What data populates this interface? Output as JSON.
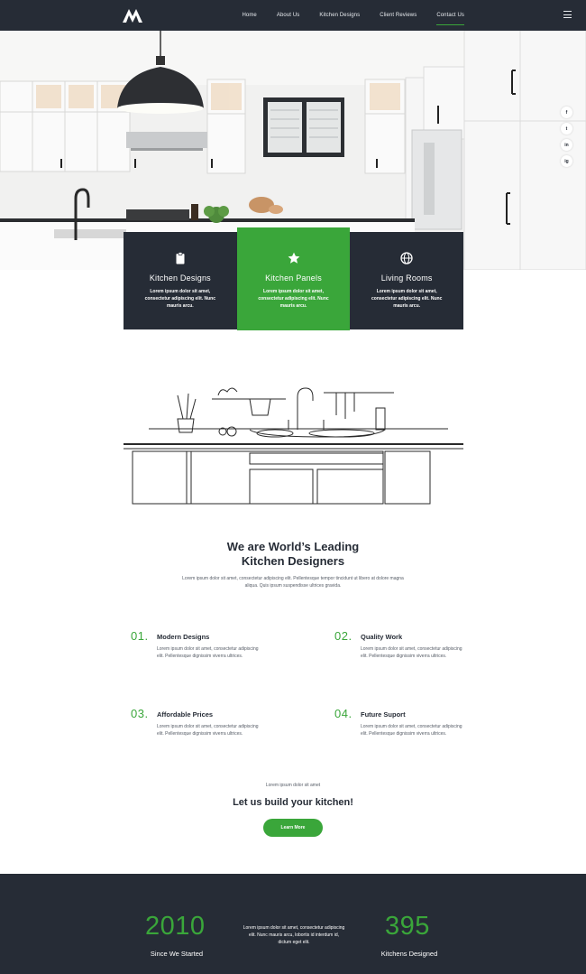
{
  "nav": {
    "links": [
      "Home",
      "About Us",
      "Kitchen Designs",
      "Client Reviews",
      "Contact Us"
    ],
    "active_index": 4
  },
  "social": [
    "f",
    "t",
    "in",
    "ig"
  ],
  "cards": [
    {
      "icon": "clipboard-icon",
      "title": "Kitchen Designs",
      "text": "Lorem ipsum dolor sit amet, consectetur adipiscing elit. Nunc mauris arcu."
    },
    {
      "icon": "star-icon",
      "title": "Kitchen Panels",
      "text": "Lorem ipsum dolor sit amet, consectetur adipiscing elit. Nunc mauris arcu."
    },
    {
      "icon": "globe-icon",
      "title": "Living Rooms",
      "text": "Lorem ipsum dolor sit amet, consectetur adipiscing elit. Nunc mauris arcu."
    }
  ],
  "intro": {
    "title_line1": "We are World’s Leading",
    "title_line2": "Kitchen Designers",
    "text": "Lorem ipsum dolor sit amet, consectetur adipiscing elit. Pellentesque tempor tincidunt ut libero at dolore magna aliqua. Quis ipsum suspendisse ultrices gravida."
  },
  "features": [
    {
      "num": "01.",
      "title": "Modern Designs",
      "text": "Lorem ipsum dolor sit amet, consectetur adipiscing elit. Pellentesque dignissim viverra ultrices."
    },
    {
      "num": "02.",
      "title": "Quality Work",
      "text": "Lorem ipsum dolor sit amet, consectetur adipiscing elit. Pellentesque dignissim viverra ultrices."
    },
    {
      "num": "03.",
      "title": "Affordable Prices",
      "text": "Lorem ipsum dolor sit amet, consectetur adipiscing elit. Pellentesque dignissim viverra ultrices."
    },
    {
      "num": "04.",
      "title": "Future Suport",
      "text": "Lorem ipsum dolor sit amet, consectetur adipiscing elit. Pellentesque dignissim viverra ultrices."
    }
  ],
  "cta": {
    "small": "Lorem ipsum dolor sit amet",
    "title": "Let us build your kitchen!",
    "button": "Learn More"
  },
  "stats": {
    "left_num": "2010",
    "left_label": "Since We Started",
    "text": "Lorem ipsum dolor sit amet, consectetur adipiscing elit. Nunc mauris arcu, lobortis id interdum id, dictum eget elit.",
    "right_num": "395",
    "right_label": "Kitchens Designed"
  },
  "colors": {
    "dark": "#262c36",
    "accent": "#3aa63a"
  }
}
